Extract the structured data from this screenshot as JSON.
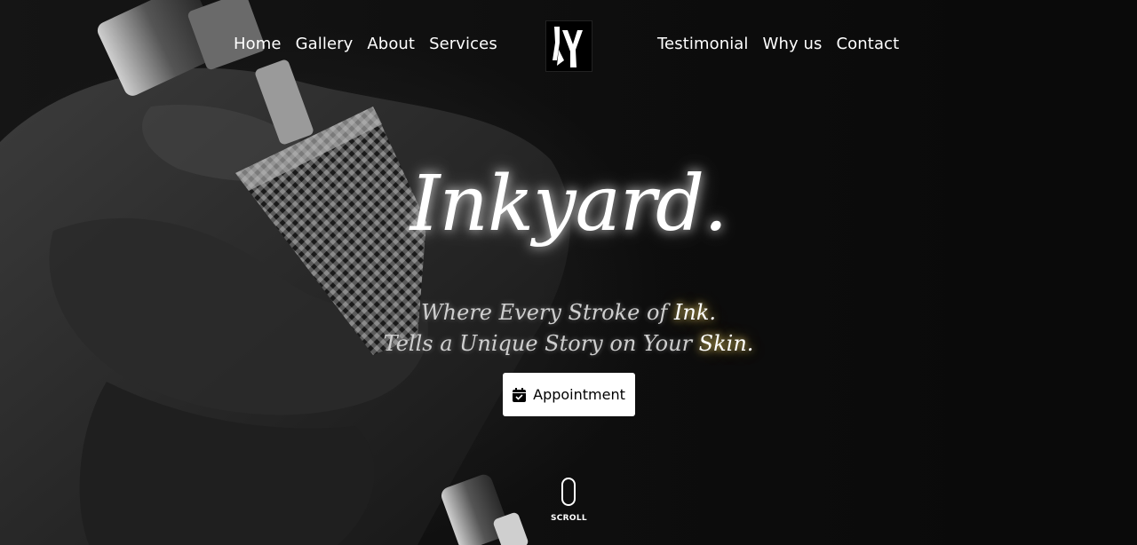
{
  "nav": {
    "left": [
      {
        "label": "Home"
      },
      {
        "label": "Gallery"
      },
      {
        "label": "About"
      },
      {
        "label": "Services"
      }
    ],
    "right": [
      {
        "label": "Testimonial"
      },
      {
        "label": "Why us"
      },
      {
        "label": "Contact"
      }
    ]
  },
  "logo": {
    "alt": "IY"
  },
  "hero": {
    "title": "Inkyard.",
    "tagline_line1_before": "Where Every Stroke of ",
    "tagline_line1_accent": "Ink.",
    "tagline_line2_before": "Tells a Unique Story on Your ",
    "tagline_line2_accent": "Skin.",
    "cta_label": "Appointment",
    "cta_icon": "calendar-check-icon"
  },
  "scroll": {
    "label": "SCROLL",
    "icon": "mouse-icon"
  },
  "colors": {
    "background": "#0b0b0b",
    "text": "#ffffff",
    "accent_glow": "#ffd968",
    "button_bg": "#ffffff"
  }
}
